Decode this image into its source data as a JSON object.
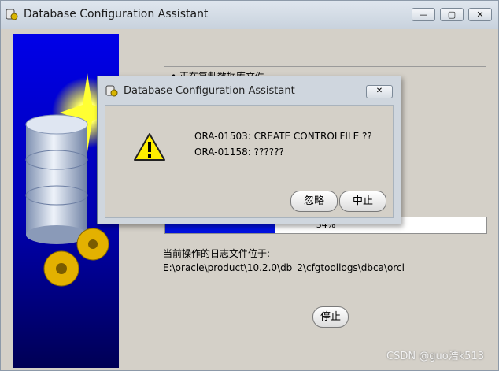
{
  "window": {
    "title": "Database Configuration Assistant",
    "minimize_glyph": "—",
    "maximize_glyph": "▢",
    "close_glyph": "✕"
  },
  "main": {
    "status_text_obscured": "• 正在复制数据库文件",
    "progress_percent": 34,
    "progress_label": "34%",
    "log_heading": "当前操作的日志文件位于:",
    "log_path": "E:\\oracle\\product\\10.2.0\\db_2\\cfgtoollogs\\dbca\\orcl",
    "stop_label": "停止"
  },
  "dialog": {
    "title": "Database Configuration Assistant",
    "close_glyph": "✕",
    "icon": "warning-icon",
    "messages": [
      "ORA-01503: CREATE CONTROLFILE ??",
      "ORA-01158: ??????"
    ],
    "ignore_label": "忽略",
    "abort_label": "中止"
  },
  "watermark": "CSDN @guo浩k513",
  "colors": {
    "side_panel": "#0000c8",
    "progress_fill": "#0010e0",
    "warning": "#ffee00"
  }
}
